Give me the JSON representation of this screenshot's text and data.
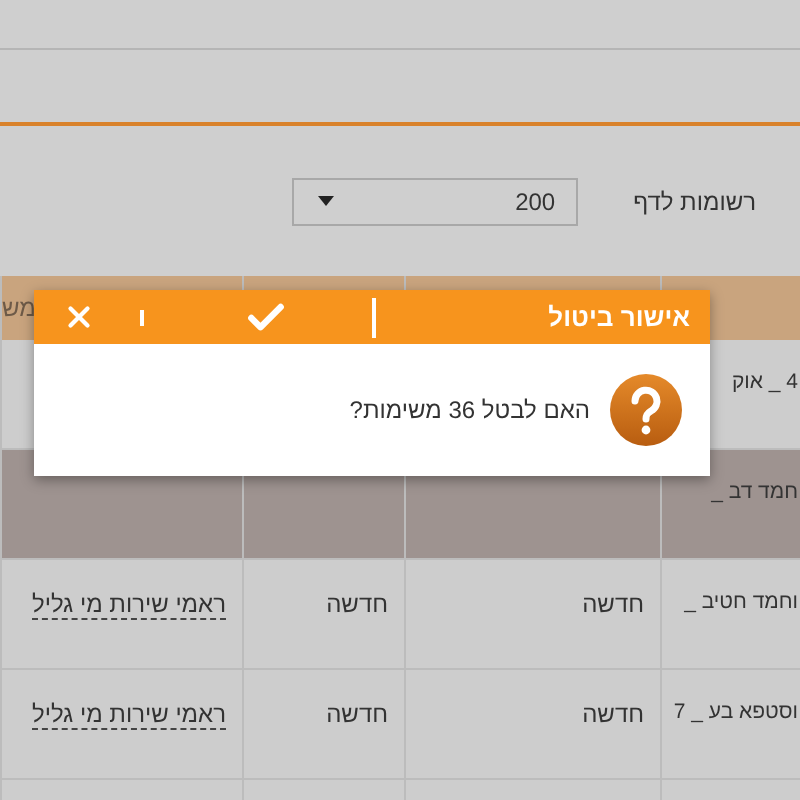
{
  "rows_per_page": {
    "label": "רשומות לדף",
    "value": "200"
  },
  "table": {
    "header_cut_text": "מש",
    "rows": [
      {
        "highlighted": false,
        "name": "4 _ אוק"
      },
      {
        "highlighted": true,
        "name": "חמד דב _"
      },
      {
        "highlighted": false,
        "name": "וחמד חטיב _",
        "status_1": "חדשה",
        "status_2": "חדשה",
        "service": "ראמי שירות מי גליל"
      },
      {
        "highlighted": false,
        "name": "וסטפא בע _ 7",
        "status_1": "חדשה",
        "status_2": "חדשה",
        "service": "ראמי שירות מי גליל"
      }
    ]
  },
  "dialog": {
    "title": "אישור ביטול",
    "message": "האם לבטל 36 משימות?"
  }
}
